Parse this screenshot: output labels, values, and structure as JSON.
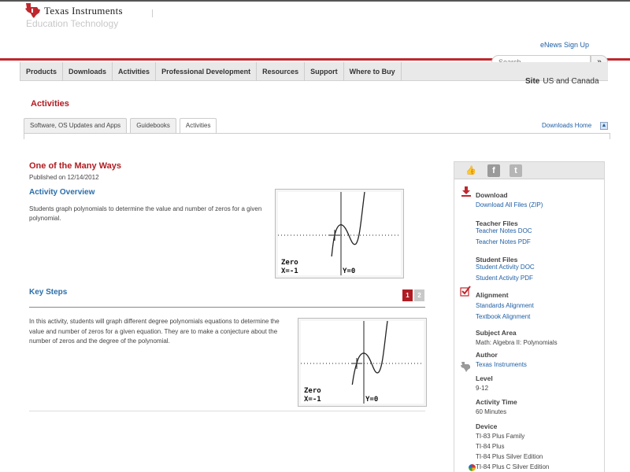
{
  "brand": {
    "name": "Texas Instruments",
    "sub": "Education Technology"
  },
  "header": {
    "enews": "eNews Sign Up",
    "search_placeholder": "Search",
    "search_button": "»",
    "site_label": "Site",
    "site_value": "US and Canada"
  },
  "nav": [
    "Products",
    "Downloads",
    "Activities",
    "Professional Development",
    "Resources",
    "Support",
    "Where to Buy"
  ],
  "page": {
    "title": "Activities",
    "tabs": [
      "Software, OS Updates and Apps",
      "Guidebooks",
      "Activities"
    ],
    "downloads_home": "Downloads Home"
  },
  "activity": {
    "title": "One of the Many Ways",
    "published": "Published on 12/14/2012",
    "overview_heading": "Activity Overview",
    "overview_text": "Students graph polynomials to determine the value and number of zeros for a given polynomial.",
    "keysteps_heading": "Key Steps",
    "keysteps_text": "In this activity, students will graph different degree polynomials equations to determine the value and number of zeros for a given equation. They are to make a conjecture about the number of zeros and the degree of the polynomial.",
    "pages": [
      "1",
      "2"
    ]
  },
  "calc": {
    "line1": "Zero",
    "line2": "X=-1",
    "line3": "Y=0"
  },
  "sidebar": {
    "download_h": "Download",
    "download_all": "Download All Files (ZIP)",
    "teacher_h": "Teacher Files",
    "teacher_doc": "Teacher Notes DOC",
    "teacher_pdf": "Teacher Notes PDF",
    "student_h": "Student Files",
    "student_doc": "Student Activity DOC",
    "student_pdf": "Student Activity PDF",
    "alignment_h": "Alignment",
    "standards": "Standards Alignment",
    "textbook": "Textbook Alignment",
    "subject_h": "Subject Area",
    "subject_v": "Math: Algebra II: Polynomials",
    "author_h": "Author",
    "author_v": "Texas Instruments",
    "level_h": "Level",
    "level_v": "9-12",
    "time_h": "Activity Time",
    "time_v": "60 Minutes",
    "device_h": "Device",
    "devices": [
      "TI-83 Plus Family",
      "TI-84 Plus",
      "TI-84 Plus Silver Edition",
      "TI-84 Plus C Silver Edition"
    ]
  },
  "colors": {
    "accent_red": "#b01c22",
    "link_blue": "#1f5fa6",
    "heading_blue": "#2a6eaa"
  }
}
